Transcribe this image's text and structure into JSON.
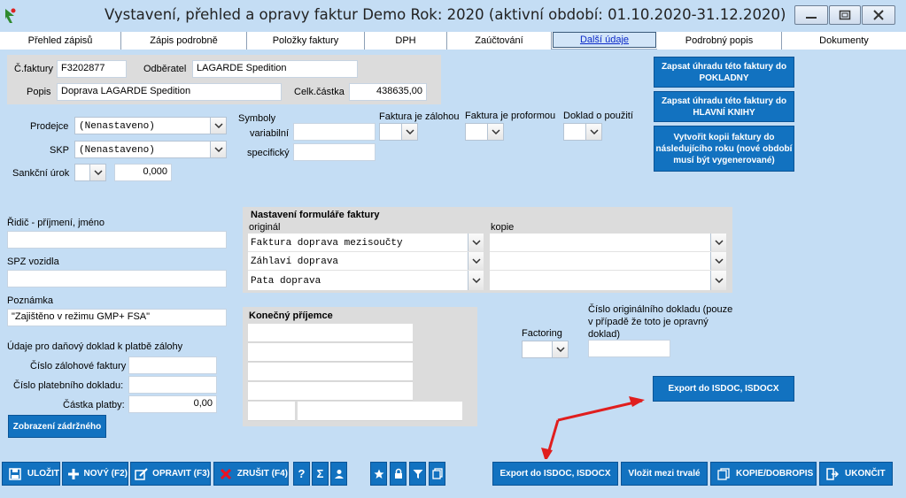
{
  "window": {
    "title": "Vystavení, přehled a opravy faktur  Demo  Rok: 2020 (aktivní období: 01.10.2020-31.12.2020)"
  },
  "tabs": [
    {
      "label": "Přehled zápisů"
    },
    {
      "label": "Zápis podrobně"
    },
    {
      "label": "Položky faktury"
    },
    {
      "label": "DPH"
    },
    {
      "label": "Zaúčtování"
    },
    {
      "label": "Další údaje"
    },
    {
      "label": "Podrobný popis"
    },
    {
      "label": "Dokumenty"
    }
  ],
  "header": {
    "cfaktury_label": "Č.faktury",
    "cfaktury_value": "F3202877",
    "odberatel_label": "Odběratel",
    "odberatel_value": "LAGARDE Spedition",
    "popis_label": "Popis",
    "popis_value": "Doprava LAGARDE Spedition",
    "celk_label": "Celk.částka",
    "celk_value": "438635,00"
  },
  "form": {
    "prodejce_label": "Prodejce",
    "prodejce_value": "(Nenastaveno)",
    "skp_label": "SKP",
    "skp_value": "(Nenastaveno)",
    "sankcni_label": "Sankční úrok",
    "sankcni_value": "0,000",
    "symboly_label": "Symboly",
    "variabilni_label": "variabilní",
    "specificky_label": "specifický",
    "zalohou_label": "Faktura je zálohou",
    "proformou_label": "Faktura je proformou",
    "doklad_pouziti_label": "Doklad o použití",
    "ridic_label": "Řidič - příjmení, jméno",
    "spz_label": "SPZ vozidla",
    "poznamka_label": "Poznámka",
    "poznamka_value": "\"Zajištěno v režimu GMP+ FSA\"",
    "udaje_label": "Údaje pro daňový doklad k platbě zálohy",
    "cislo_zal_label": "Číslo zálohové faktury",
    "cislo_plat_label": "Číslo platebního dokladu:",
    "castka_label": "Částka platby:",
    "castka_value": "0,00",
    "zobrazeni_button": "Zobrazení zádržného"
  },
  "nastaveni": {
    "title": "Nastavení formuláře faktury",
    "original_label": "originál",
    "kopie_label": "kopie",
    "items": [
      "Faktura doprava mezisoučty",
      "Záhlaví doprava",
      "Pata doprava"
    ]
  },
  "prijemce": {
    "title": "Konečný příjemce"
  },
  "factoring": {
    "label": "Factoring",
    "cislo_orig_label": "Číslo originálního dokladu (pouze v případě že toto je opravný doklad)"
  },
  "side_buttons": {
    "pokladny": "Zapsat úhradu této faktury do POKLADNY",
    "hlavni_knihy": "Zapsat úhradu této faktury do HLAVNÍ KNIHY",
    "kopie_roku": "Vytvořit kopii faktury do následujícího roku (nové období musí být vygenerované)",
    "export": "Export do ISDOC, ISDOCX"
  },
  "toolbar": {
    "ulozit": "ULOŽIT",
    "novy": "NOVÝ (F2)",
    "opravit": "OPRAVIT (F3)",
    "zrusit": "ZRUŠIT (F4)",
    "help": "?",
    "sum": "Σ",
    "export": "Export do ISDOC, ISDOCX",
    "vlozit": "Vložit mezi trvalé",
    "kopie": "KOPIE/DOBROPIS",
    "ukoncit": "UKONČIT"
  },
  "colors": {
    "background": "#c4ddf4",
    "button": "#1272c0",
    "arrow": "#e01e1e"
  }
}
